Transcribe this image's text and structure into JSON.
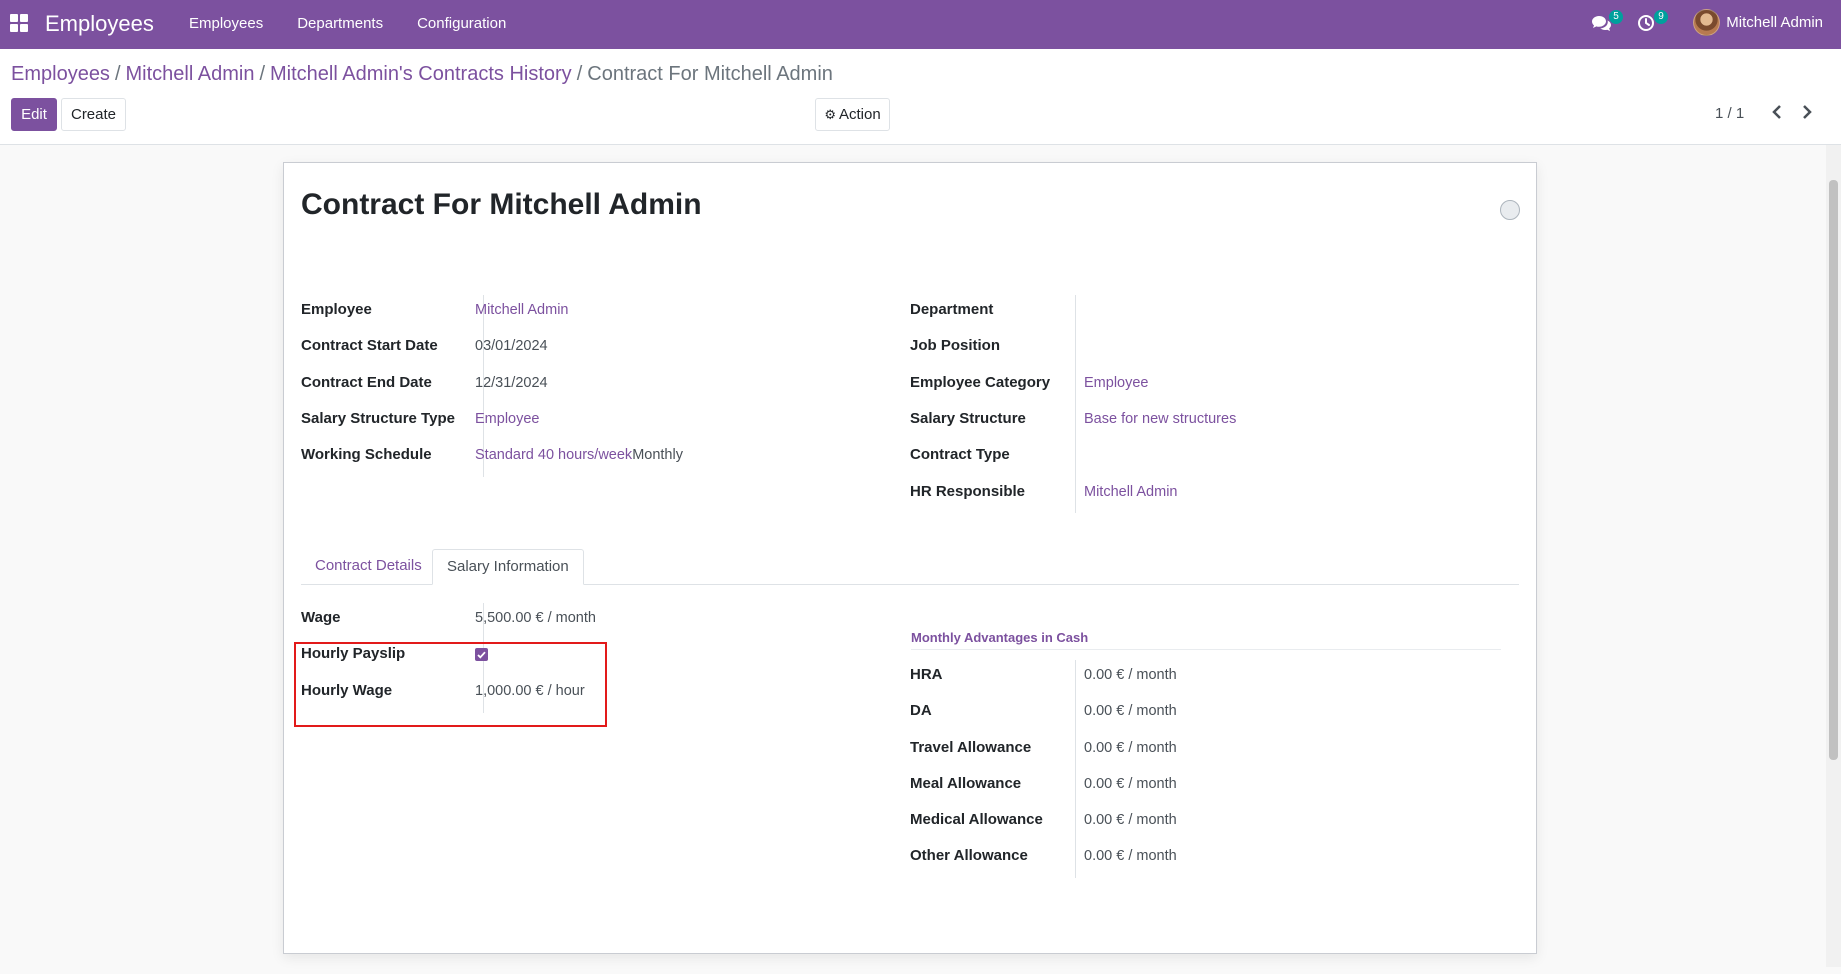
{
  "navbar": {
    "app_name": "Employees",
    "menu": [
      "Employees",
      "Departments",
      "Configuration"
    ],
    "messages_badge": "5",
    "activity_badge": "9",
    "user_name": "Mitchell Admin"
  },
  "breadcrumb": {
    "items": [
      "Employees",
      "Mitchell Admin",
      "Mitchell Admin's Contracts History"
    ],
    "separator": "/",
    "current": "Contract For Mitchell Admin"
  },
  "toolbar": {
    "edit_label": "Edit",
    "create_label": "Create",
    "action_label": "Action"
  },
  "pager": {
    "value": "1 / 1"
  },
  "form": {
    "title": "Contract For Mitchell Admin",
    "left": {
      "employee_label": "Employee",
      "employee_value": "Mitchell Admin",
      "start_label": "Contract Start Date",
      "start_value": "03/01/2024",
      "end_label": "Contract End Date",
      "end_value": "12/31/2024",
      "sst_label": "Salary Structure Type",
      "sst_value": "Employee",
      "schedule_label": "Working Schedule",
      "schedule_link": "Standard 40 hours/week",
      "schedule_suffix": "Monthly"
    },
    "right": {
      "department_label": "Department",
      "job_label": "Job Position",
      "category_label": "Employee Category",
      "category_value": "Employee",
      "structure_label": "Salary Structure",
      "structure_value": "Base for new structures",
      "type_label": "Contract Type",
      "hr_label": "HR Responsible",
      "hr_value": "Mitchell Admin"
    },
    "tabs": [
      "Contract Details",
      "Salary Information"
    ],
    "salary": {
      "wage_label": "Wage",
      "wage_value": "5,500.00 €",
      "wage_unit": "/ month",
      "hourly_payslip_label": "Hourly Payslip",
      "hourly_payslip_checked": true,
      "hourly_wage_label": "Hourly Wage",
      "hourly_wage_value": "1,000.00 €",
      "hourly_wage_unit": "/ hour"
    },
    "advantages": {
      "title": "Monthly Advantages in Cash",
      "items": [
        {
          "label": "HRA",
          "value": "0.00 €",
          "unit": "/ month"
        },
        {
          "label": "DA",
          "value": "0.00 €",
          "unit": "/ month"
        },
        {
          "label": "Travel Allowance",
          "value": "0.00 €",
          "unit": "/ month"
        },
        {
          "label": "Meal Allowance",
          "value": "0.00 €",
          "unit": "/ month"
        },
        {
          "label": "Medical Allowance",
          "value": "0.00 €",
          "unit": "/ month"
        },
        {
          "label": "Other Allowance",
          "value": "0.00 €",
          "unit": "/ month"
        }
      ]
    }
  },
  "colors": {
    "primary": "#7c519f",
    "badge": "#00a09d",
    "highlight": "#e21a1a"
  }
}
